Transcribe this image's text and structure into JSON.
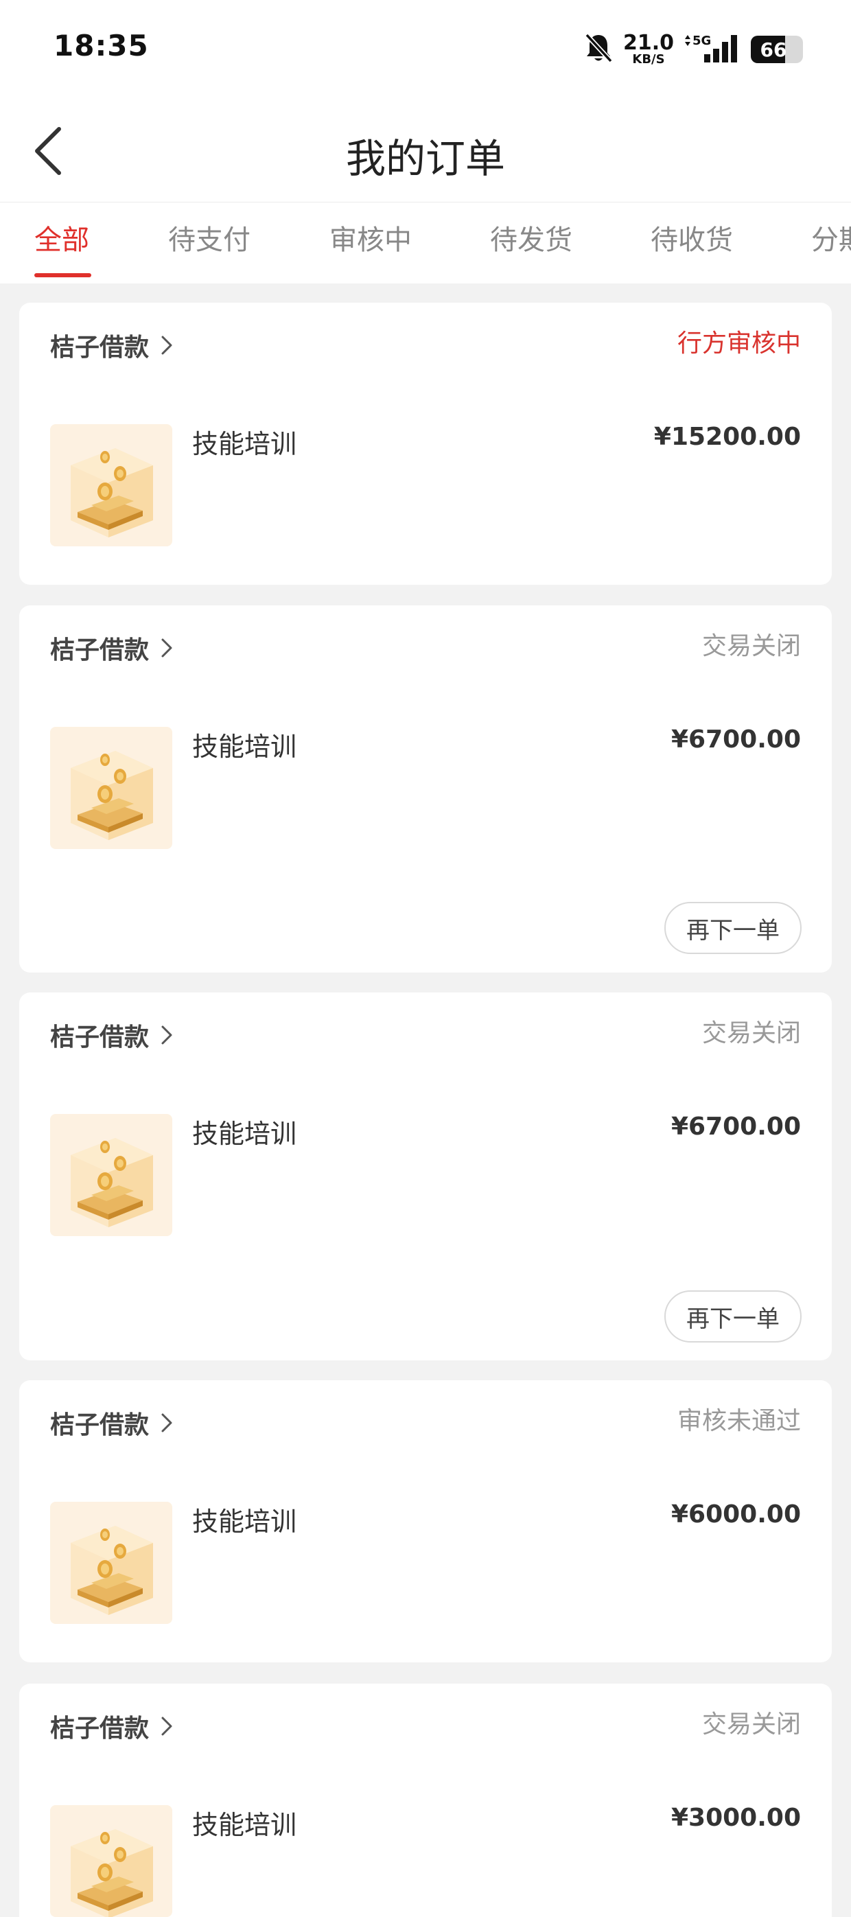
{
  "status_bar": {
    "time": "18:35",
    "net_speed_value": "21.0",
    "net_speed_unit": "KB/S",
    "network": "5G",
    "battery_level": "66",
    "battery_fraction": 0.66
  },
  "header": {
    "title": "我的订单"
  },
  "tabs": [
    {
      "label": "全部"
    },
    {
      "label": "待支付"
    },
    {
      "label": "审核中"
    },
    {
      "label": "待发货"
    },
    {
      "label": "待收货"
    },
    {
      "label": "分期"
    }
  ],
  "orders": [
    {
      "merchant": "桔子借款",
      "status": "行方审核中",
      "product": "技能培训",
      "price": "¥15200.00"
    },
    {
      "merchant": "桔子借款",
      "status": "交易关闭",
      "product": "技能培训",
      "price": "¥6700.00",
      "action": "再下一单"
    },
    {
      "merchant": "桔子借款",
      "status": "交易关闭",
      "product": "技能培训",
      "price": "¥6700.00",
      "action": "再下一单"
    },
    {
      "merchant": "桔子借款",
      "status": "审核未通过",
      "product": "技能培训",
      "price": "¥6000.00"
    },
    {
      "merchant": "桔子借款",
      "status": "交易关闭",
      "product": "技能培训",
      "price": "¥3000.00"
    }
  ],
  "colors": {
    "accent": "#e0302b",
    "status_red": "#d9332e",
    "status_gray": "#999999",
    "background": "#f2f2f2"
  }
}
